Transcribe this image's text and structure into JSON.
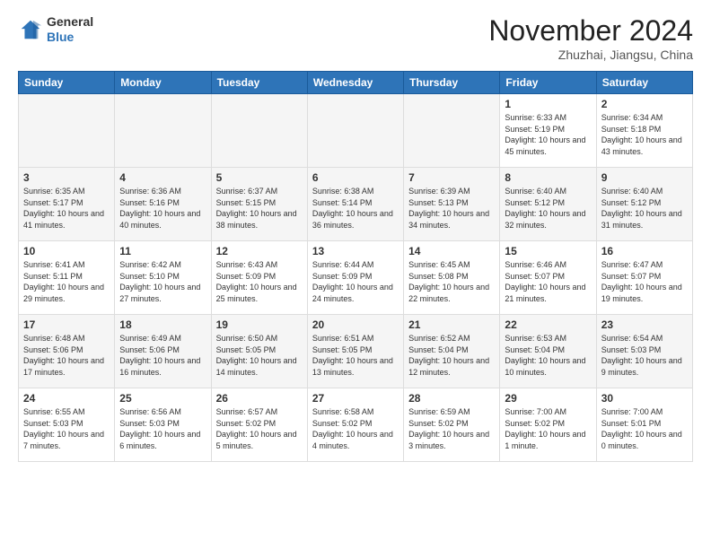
{
  "header": {
    "logo_line1": "General",
    "logo_line2": "Blue",
    "month": "November 2024",
    "location": "Zhuzhai, Jiangsu, China"
  },
  "days_of_week": [
    "Sunday",
    "Monday",
    "Tuesday",
    "Wednesday",
    "Thursday",
    "Friday",
    "Saturday"
  ],
  "weeks": [
    [
      {
        "day": "",
        "empty": true
      },
      {
        "day": "",
        "empty": true
      },
      {
        "day": "",
        "empty": true
      },
      {
        "day": "",
        "empty": true
      },
      {
        "day": "",
        "empty": true
      },
      {
        "day": "1",
        "sunrise": "6:33 AM",
        "sunset": "5:19 PM",
        "daylight": "10 hours and 45 minutes."
      },
      {
        "day": "2",
        "sunrise": "6:34 AM",
        "sunset": "5:18 PM",
        "daylight": "10 hours and 43 minutes."
      }
    ],
    [
      {
        "day": "3",
        "sunrise": "6:35 AM",
        "sunset": "5:17 PM",
        "daylight": "10 hours and 41 minutes."
      },
      {
        "day": "4",
        "sunrise": "6:36 AM",
        "sunset": "5:16 PM",
        "daylight": "10 hours and 40 minutes."
      },
      {
        "day": "5",
        "sunrise": "6:37 AM",
        "sunset": "5:15 PM",
        "daylight": "10 hours and 38 minutes."
      },
      {
        "day": "6",
        "sunrise": "6:38 AM",
        "sunset": "5:14 PM",
        "daylight": "10 hours and 36 minutes."
      },
      {
        "day": "7",
        "sunrise": "6:39 AM",
        "sunset": "5:13 PM",
        "daylight": "10 hours and 34 minutes."
      },
      {
        "day": "8",
        "sunrise": "6:40 AM",
        "sunset": "5:12 PM",
        "daylight": "10 hours and 32 minutes."
      },
      {
        "day": "9",
        "sunrise": "6:40 AM",
        "sunset": "5:12 PM",
        "daylight": "10 hours and 31 minutes."
      }
    ],
    [
      {
        "day": "10",
        "sunrise": "6:41 AM",
        "sunset": "5:11 PM",
        "daylight": "10 hours and 29 minutes."
      },
      {
        "day": "11",
        "sunrise": "6:42 AM",
        "sunset": "5:10 PM",
        "daylight": "10 hours and 27 minutes."
      },
      {
        "day": "12",
        "sunrise": "6:43 AM",
        "sunset": "5:09 PM",
        "daylight": "10 hours and 25 minutes."
      },
      {
        "day": "13",
        "sunrise": "6:44 AM",
        "sunset": "5:09 PM",
        "daylight": "10 hours and 24 minutes."
      },
      {
        "day": "14",
        "sunrise": "6:45 AM",
        "sunset": "5:08 PM",
        "daylight": "10 hours and 22 minutes."
      },
      {
        "day": "15",
        "sunrise": "6:46 AM",
        "sunset": "5:07 PM",
        "daylight": "10 hours and 21 minutes."
      },
      {
        "day": "16",
        "sunrise": "6:47 AM",
        "sunset": "5:07 PM",
        "daylight": "10 hours and 19 minutes."
      }
    ],
    [
      {
        "day": "17",
        "sunrise": "6:48 AM",
        "sunset": "5:06 PM",
        "daylight": "10 hours and 17 minutes."
      },
      {
        "day": "18",
        "sunrise": "6:49 AM",
        "sunset": "5:06 PM",
        "daylight": "10 hours and 16 minutes."
      },
      {
        "day": "19",
        "sunrise": "6:50 AM",
        "sunset": "5:05 PM",
        "daylight": "10 hours and 14 minutes."
      },
      {
        "day": "20",
        "sunrise": "6:51 AM",
        "sunset": "5:05 PM",
        "daylight": "10 hours and 13 minutes."
      },
      {
        "day": "21",
        "sunrise": "6:52 AM",
        "sunset": "5:04 PM",
        "daylight": "10 hours and 12 minutes."
      },
      {
        "day": "22",
        "sunrise": "6:53 AM",
        "sunset": "5:04 PM",
        "daylight": "10 hours and 10 minutes."
      },
      {
        "day": "23",
        "sunrise": "6:54 AM",
        "sunset": "5:03 PM",
        "daylight": "10 hours and 9 minutes."
      }
    ],
    [
      {
        "day": "24",
        "sunrise": "6:55 AM",
        "sunset": "5:03 PM",
        "daylight": "10 hours and 7 minutes."
      },
      {
        "day": "25",
        "sunrise": "6:56 AM",
        "sunset": "5:03 PM",
        "daylight": "10 hours and 6 minutes."
      },
      {
        "day": "26",
        "sunrise": "6:57 AM",
        "sunset": "5:02 PM",
        "daylight": "10 hours and 5 minutes."
      },
      {
        "day": "27",
        "sunrise": "6:58 AM",
        "sunset": "5:02 PM",
        "daylight": "10 hours and 4 minutes."
      },
      {
        "day": "28",
        "sunrise": "6:59 AM",
        "sunset": "5:02 PM",
        "daylight": "10 hours and 3 minutes."
      },
      {
        "day": "29",
        "sunrise": "7:00 AM",
        "sunset": "5:02 PM",
        "daylight": "10 hours and 1 minute."
      },
      {
        "day": "30",
        "sunrise": "7:00 AM",
        "sunset": "5:01 PM",
        "daylight": "10 hours and 0 minutes."
      }
    ]
  ]
}
